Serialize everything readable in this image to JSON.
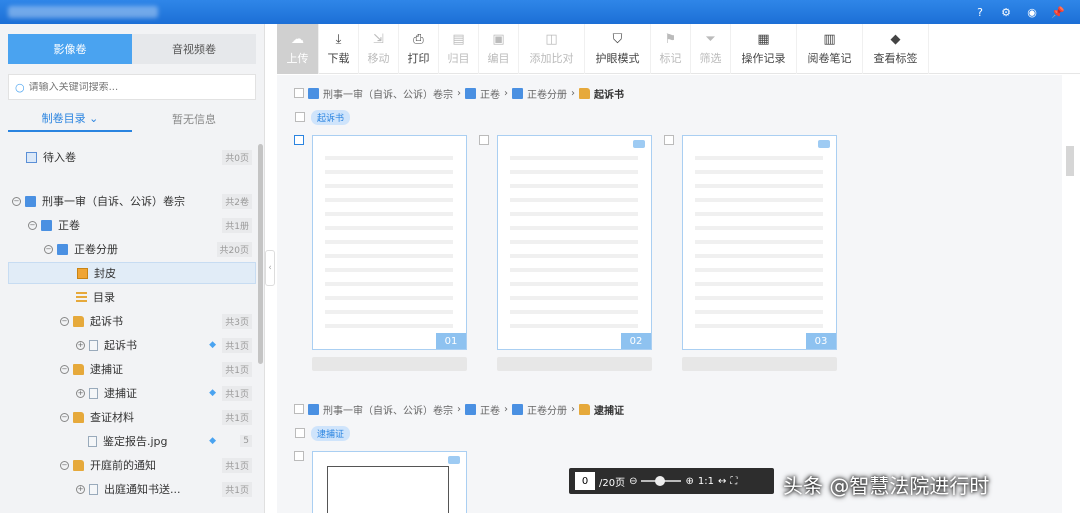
{
  "left": {
    "media_tabs": [
      "影像卷",
      "音视频卷"
    ],
    "search_placeholder": "请输入关键词搜索...",
    "sub_tabs": [
      "制卷目录",
      "暂无信息"
    ],
    "tree": [
      {
        "label": "待入卷",
        "count": "共0页"
      },
      {
        "label": "刑事一审（自诉、公诉）卷宗",
        "count": "共2卷"
      },
      {
        "label": "正卷",
        "count": "共1册"
      },
      {
        "label": "正卷分册",
        "count": "共20页"
      },
      {
        "label": "封皮",
        "count": ""
      },
      {
        "label": "目录",
        "count": ""
      },
      {
        "label": "起诉书",
        "count": "共3页"
      },
      {
        "label": "起诉书",
        "count": "共1页"
      },
      {
        "label": "逮捕证",
        "count": "共1页"
      },
      {
        "label": "逮捕证",
        "count": "共1页"
      },
      {
        "label": "查证材料",
        "count": "共1页"
      },
      {
        "label": "鉴定报告.jpg",
        "count": "5"
      },
      {
        "label": "开庭前的通知",
        "count": "共1页"
      },
      {
        "label": "出庭通知书送...",
        "count": "共1页"
      }
    ]
  },
  "toolbar": [
    "上传",
    "下载",
    "移动",
    "打印",
    "归目",
    "编目",
    "添加比对",
    "护眼模式",
    "标记",
    "筛选",
    "操作记录",
    "阅卷笔记",
    "查看标签"
  ],
  "main": {
    "section1": {
      "crumbs": [
        "刑事一审（自诉、公诉）卷宗",
        "正卷",
        "正卷分册",
        "起诉书"
      ],
      "chip": "起诉书",
      "pages": [
        "01",
        "02",
        "03"
      ]
    },
    "section2": {
      "crumbs": [
        "刑事一审（自诉、公诉）卷宗",
        "正卷",
        "正卷分册",
        "逮捕证"
      ],
      "chip": "逮捕证"
    }
  },
  "zoom": {
    "page": "0",
    "total": "/20页",
    "ratio": "1:1"
  },
  "watermark": "头条 @智慧法院进行时"
}
